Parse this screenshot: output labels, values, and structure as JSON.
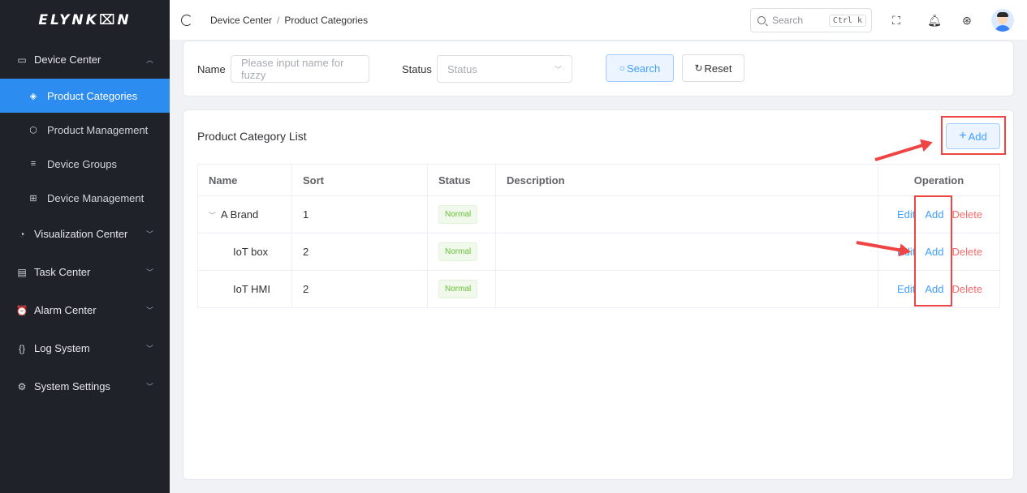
{
  "app": {
    "logo": "ELYNK⌧N"
  },
  "sidebar": {
    "groups": [
      {
        "label": "Device Center",
        "icon": "monitor-icon"
      },
      {
        "label": "Visualization Center",
        "icon": "chart-icon"
      },
      {
        "label": "Task Center",
        "icon": "clipboard-icon"
      },
      {
        "label": "Alarm Center",
        "icon": "alarm-icon"
      },
      {
        "label": "Log System",
        "icon": "code-icon"
      },
      {
        "label": "System Settings",
        "icon": "gear-icon"
      }
    ],
    "sub_items": [
      {
        "label": "Product Categories",
        "icon": "layers-icon",
        "active": true
      },
      {
        "label": "Product Management",
        "icon": "box-icon"
      },
      {
        "label": "Device Groups",
        "icon": "list-icon"
      },
      {
        "label": "Device Management",
        "icon": "tree-icon"
      }
    ]
  },
  "header": {
    "breadcrumb": [
      "Device Center",
      "Product Categories"
    ],
    "search_placeholder": "Search",
    "search_shortcut": "Ctrl k"
  },
  "filter": {
    "name_label": "Name",
    "name_placeholder": "Please input name for fuzzy",
    "status_label": "Status",
    "status_placeholder": "Status",
    "search_button": "Search",
    "reset_button": "Reset"
  },
  "list": {
    "title": "Product Category List",
    "add_button": "Add",
    "columns": [
      "Name",
      "Sort",
      "Status",
      "Description",
      "Operation"
    ],
    "rows": [
      {
        "name": "A Brand",
        "sort": "1",
        "status": "Normal",
        "description": "",
        "expandable": true
      },
      {
        "name": "IoT box",
        "sort": "2",
        "status": "Normal",
        "description": ""
      },
      {
        "name": "IoT HMI",
        "sort": "2",
        "status": "Normal",
        "description": ""
      }
    ],
    "ops": {
      "edit": "Edit",
      "add": "Add",
      "delete": "Delete"
    }
  },
  "colors": {
    "accent": "#409eff",
    "sidebar_bg": "#1f2329",
    "active": "#2d8cf0",
    "danger": "#f56c6c",
    "annotation": "#ef4444"
  }
}
